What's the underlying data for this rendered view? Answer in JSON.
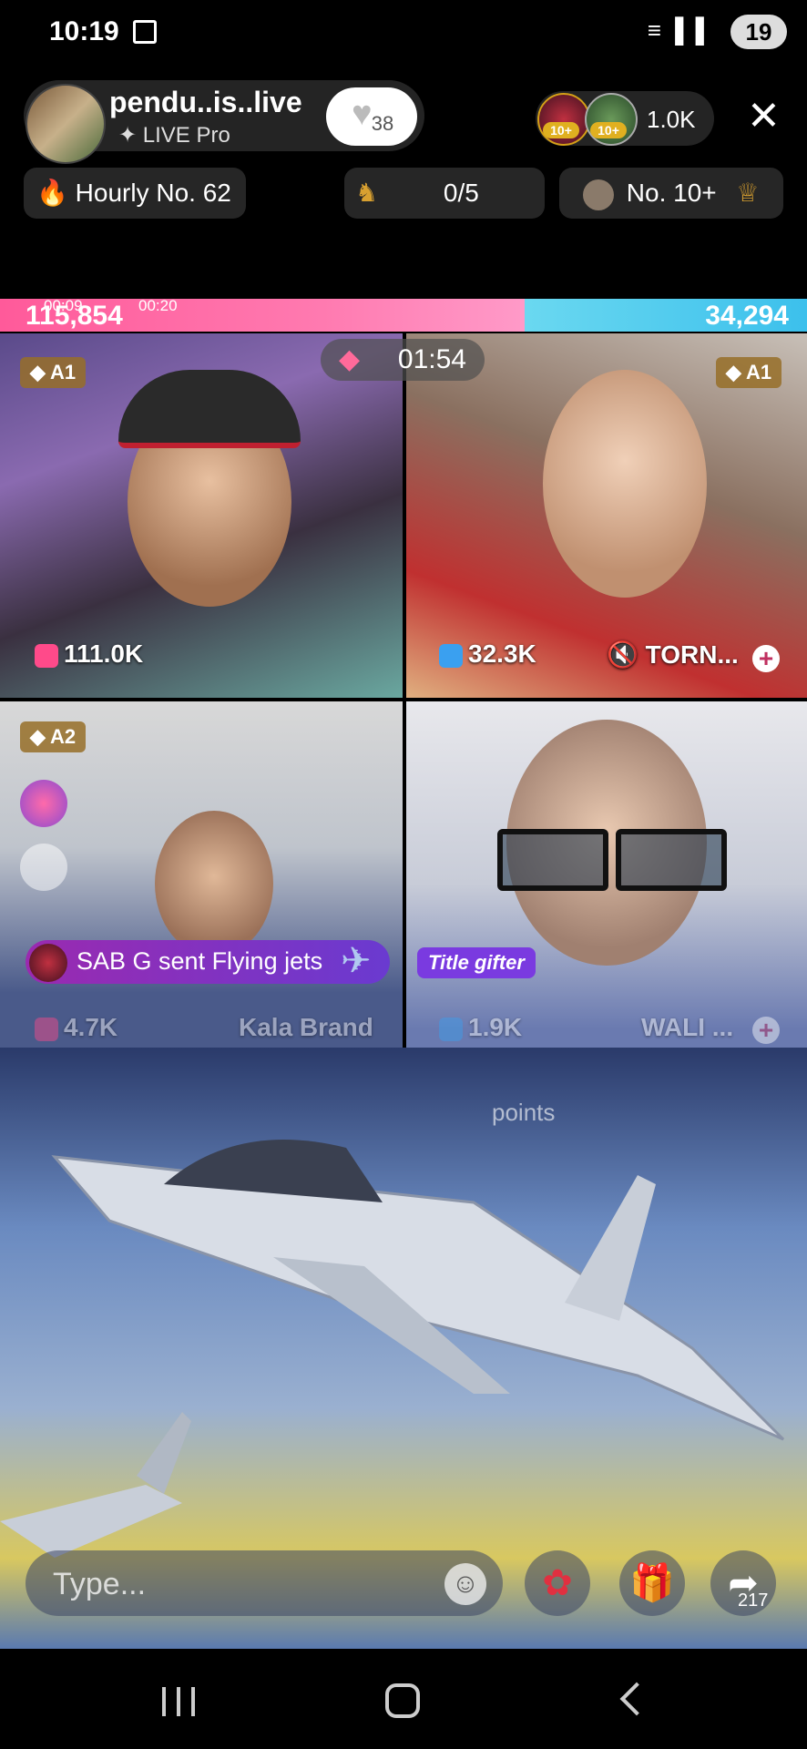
{
  "status_bar": {
    "time": "10:19",
    "battery": "19"
  },
  "host": {
    "name": "pendu..is..live",
    "subtitle": "LIVE Pro",
    "follow_count": "38"
  },
  "viewers": {
    "badge1": "10+",
    "badge2": "10+",
    "count": "1.0K"
  },
  "chips": {
    "hourly": "Hourly No. 62",
    "mid": "0/5",
    "rank": "No. 10+"
  },
  "battle": {
    "left_score": "115,854",
    "right_score": "34,294",
    "time_a": "00:09",
    "time_b": "00:20",
    "timer": "01:54"
  },
  "tiles": [
    {
      "rank": "A1",
      "stat": "111.0K"
    },
    {
      "rank": "A1",
      "stat": "32.3K",
      "name": "TORN..."
    },
    {
      "rank": "A2",
      "stat": "4.7K",
      "name": "Kala Brand"
    },
    {
      "stat": "1.9K",
      "name": "WALI ..."
    }
  ],
  "gift_banner": {
    "text": "SAB G sent Flying jets",
    "title_gifter": "Title gifter"
  },
  "overlay": {
    "points": "points"
  },
  "input": {
    "placeholder": "Type..."
  },
  "share": {
    "count": "217"
  },
  "colors": {
    "accent_pink": "#ff5a9a",
    "accent_blue": "#3cc0ec",
    "gift_purple": "#7a3ae0"
  }
}
